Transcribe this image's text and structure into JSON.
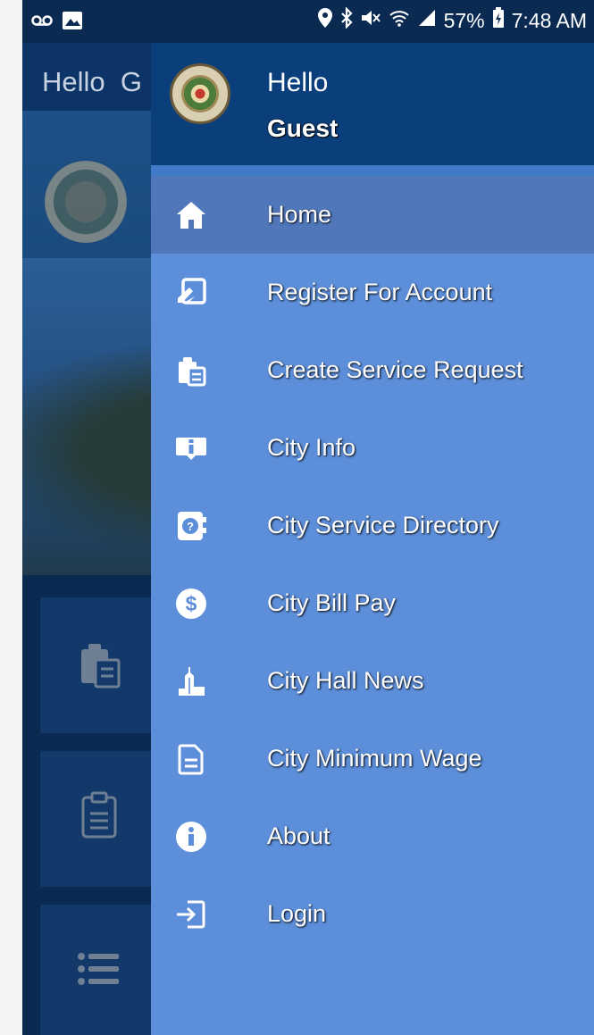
{
  "status_bar": {
    "battery": "57%",
    "time": "7:48 AM"
  },
  "background_app": {
    "greeting": "Hello",
    "initial": "G"
  },
  "drawer": {
    "greeting": "Hello",
    "user": "Guest",
    "items": [
      {
        "label": "Home",
        "icon": "home-icon",
        "active": true
      },
      {
        "label": "Register For Account",
        "icon": "register-icon"
      },
      {
        "label": "Create Service Request",
        "icon": "clipboard-icon"
      },
      {
        "label": "City Info",
        "icon": "info-board-icon"
      },
      {
        "label": "City Service Directory",
        "icon": "directory-icon"
      },
      {
        "label": "City Bill Pay",
        "icon": "dollar-icon"
      },
      {
        "label": "City Hall News",
        "icon": "city-hall-icon"
      },
      {
        "label": "City Minimum Wage",
        "icon": "document-icon"
      },
      {
        "label": "About",
        "icon": "about-icon"
      },
      {
        "label": "Login",
        "icon": "login-icon"
      }
    ]
  },
  "colors": {
    "drawer_bg": "#5c8ed9",
    "header_bg": "#0b3f7c",
    "active_item_bg": "#5077ba"
  }
}
